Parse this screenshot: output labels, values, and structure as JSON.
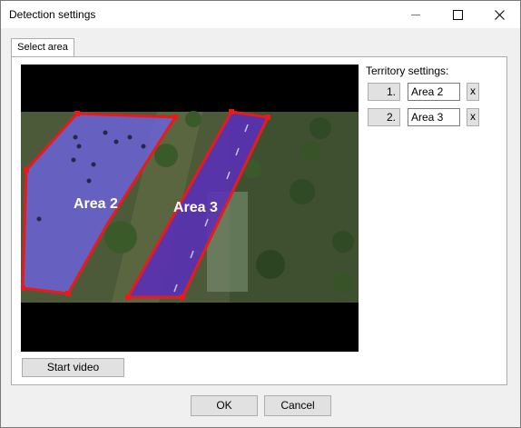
{
  "window": {
    "title": "Detection settings",
    "minimize_icon": "minimize-icon",
    "maximize_icon": "maximize-icon",
    "close_icon": "close-icon"
  },
  "tabs": [
    {
      "label": "Select area",
      "selected": true
    }
  ],
  "video": {
    "areas": [
      {
        "label": "Area 2",
        "outline_color": "#e81a1a",
        "fill_color": "#6b63d8"
      },
      {
        "label": "Area 3",
        "outline_color": "#e81a1a",
        "fill_color": "#5a2fb8"
      }
    ]
  },
  "start_video_label": "Start video",
  "territory": {
    "label": "Territory settings:",
    "rows": [
      {
        "index": "1.",
        "name": "Area 2",
        "remove_label": "x"
      },
      {
        "index": "2.",
        "name": "Area 3",
        "remove_label": "x"
      }
    ]
  },
  "footer": {
    "ok_label": "OK",
    "cancel_label": "Cancel"
  }
}
